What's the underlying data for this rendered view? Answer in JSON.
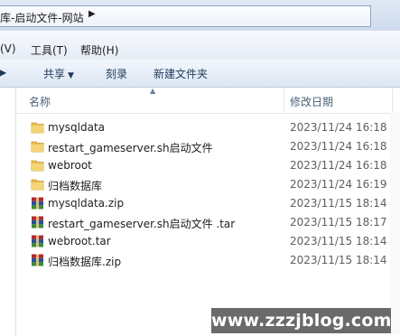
{
  "address_bar": {
    "path_text": "库-启动文件-网站",
    "arrow": "▶"
  },
  "menu": {
    "items": [
      "(V)",
      "工具(T)",
      "帮助(H)"
    ]
  },
  "toolbar": {
    "partial_label": "▶",
    "share_label": "共享",
    "burn_label": "刻录",
    "new_folder_label": "新建文件夹"
  },
  "columns": {
    "name": "名称",
    "date": "修改日期"
  },
  "files": [
    {
      "name": "mysqldata",
      "date": "2023/11/24 16:18",
      "icon": "folder-icon"
    },
    {
      "name": "restart_gameserver.sh启动文件",
      "date": "2023/11/24 16:18",
      "icon": "folder-icon"
    },
    {
      "name": "webroot",
      "date": "2023/11/24 16:18",
      "icon": "folder-icon"
    },
    {
      "name": "归档数据库",
      "date": "2023/11/24 16:19",
      "icon": "folder-icon"
    },
    {
      "name": "mysqldata.zip",
      "date": "2023/11/15 18:14",
      "icon": "winrar-archive-icon"
    },
    {
      "name": "restart_gameserver.sh启动文件 .tar",
      "date": "2023/11/15 18:17",
      "icon": "winrar-archive-icon"
    },
    {
      "name": "webroot.tar",
      "date": "2023/11/15 18:14",
      "icon": "winrar-archive-icon"
    },
    {
      "name": "归档数据库.zip",
      "date": "2023/11/15 18:14",
      "icon": "winrar-archive-icon"
    }
  ],
  "watermark": "www.zzzjblog.com",
  "colors": {
    "folder": "#e8bf4e",
    "archive_red": "#b3262b",
    "archive_blue": "#2a4f9e",
    "archive_green": "#3a8a3a"
  }
}
